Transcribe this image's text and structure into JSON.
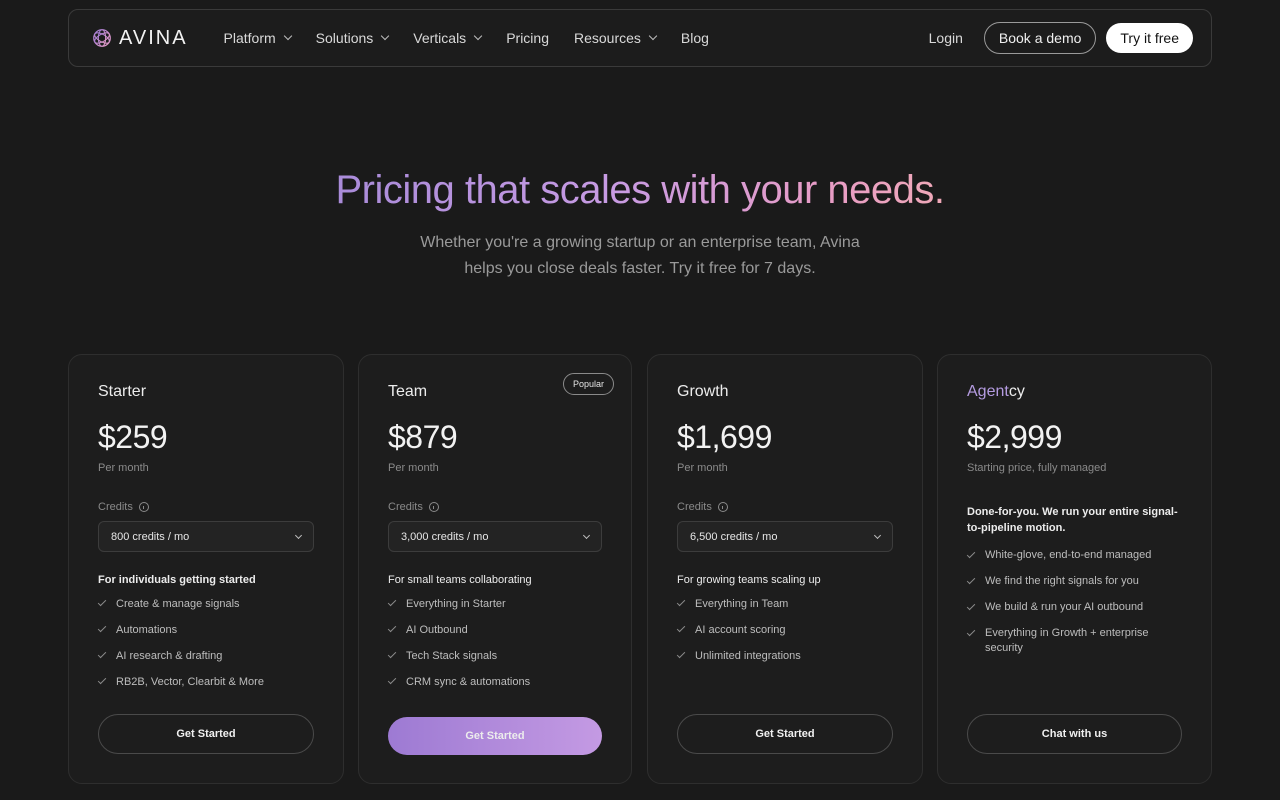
{
  "nav": {
    "brand": "AVINA",
    "items": [
      {
        "label": "Platform",
        "dropdown": true
      },
      {
        "label": "Solutions",
        "dropdown": true
      },
      {
        "label": "Verticals",
        "dropdown": true
      },
      {
        "label": "Pricing",
        "dropdown": false
      },
      {
        "label": "Resources",
        "dropdown": true
      },
      {
        "label": "Blog",
        "dropdown": false
      }
    ],
    "login": "Login",
    "book_demo": "Book a demo",
    "try_free": "Try it free"
  },
  "hero": {
    "title": "Pricing that scales with your needs.",
    "subtitle": "Whether you're a growing startup or an enterprise team, Avina helps you close deals faster. Try it free for 7 days."
  },
  "colors": {
    "background": "#1a1a1a",
    "accent_start": "#9d7ad3",
    "accent_end": "#c49ae3",
    "title_gradient": [
      "#a98bd9",
      "#c79be3",
      "#e79cc6",
      "#f0a9b8"
    ]
  },
  "plans": [
    {
      "name": "Starter",
      "price": "$259",
      "period": "Per month",
      "credits_label": "Credits",
      "credits_value": "800 credits / mo",
      "description": "For individuals getting started",
      "features": [
        "Create & manage signals",
        "Automations",
        "AI research & drafting",
        "RB2B, Vector, Clearbit & More"
      ],
      "cta": "Get Started"
    },
    {
      "name": "Team",
      "badge": "Popular",
      "price": "$879",
      "period": "Per month",
      "credits_label": "Credits",
      "credits_value": "3,000 credits / mo",
      "description": "For small teams collaborating",
      "features": [
        "Everything in Starter",
        "AI Outbound",
        "Tech Stack signals",
        "CRM sync & automations"
      ],
      "cta": "Get Started"
    },
    {
      "name": "Growth",
      "price": "$1,699",
      "period": "Per month",
      "credits_label": "Credits",
      "credits_value": "6,500 credits / mo",
      "description": "For growing teams scaling up",
      "features": [
        "Everything in Team",
        "AI account scoring",
        "Unlimited integrations"
      ],
      "cta": "Get Started"
    },
    {
      "name_highlight": "Agent",
      "name_rest": "cy",
      "price": "$2,999",
      "period": "Starting price, fully managed",
      "description": "Done-for-you. We run your entire signal-to-pipeline motion.",
      "features": [
        "White-glove, end-to-end managed",
        "We find the right signals for you",
        "We build & run your AI outbound",
        "Everything in Growth + enterprise security"
      ],
      "cta": "Chat with us"
    }
  ]
}
